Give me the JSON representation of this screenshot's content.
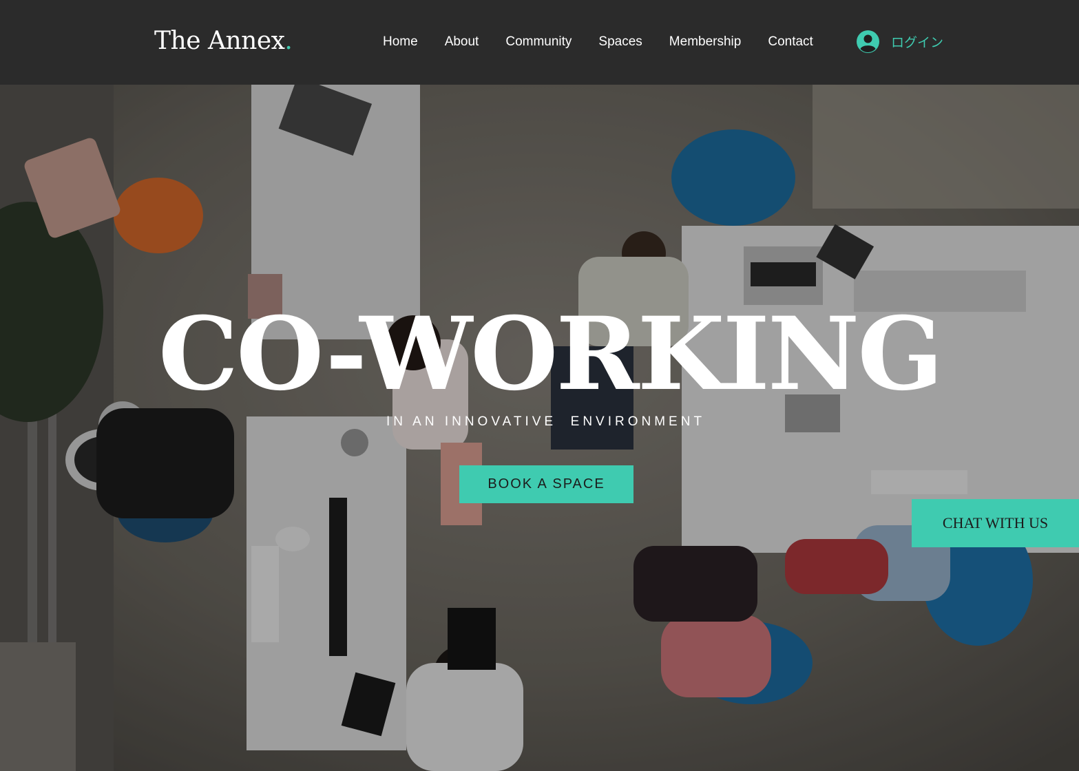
{
  "brand": {
    "name": "The Annex",
    "dot": ".",
    "accent_color": "#3fcbb0",
    "header_bg": "#2b2b2b"
  },
  "nav": {
    "items": [
      {
        "label": "Home"
      },
      {
        "label": "About"
      },
      {
        "label": "Community"
      },
      {
        "label": "Spaces"
      },
      {
        "label": "Membership"
      },
      {
        "label": "Contact"
      }
    ],
    "login": {
      "icon": "user-avatar-icon",
      "label": "ログイン"
    }
  },
  "hero": {
    "title": "CO-WORKING",
    "subtitle": "IN AN INNOVATIVE  ENVIRONMENT",
    "cta_label": "BOOK A SPACE",
    "background_image": "overhead-office-photo"
  },
  "chat": {
    "label": "CHAT WITH US"
  }
}
